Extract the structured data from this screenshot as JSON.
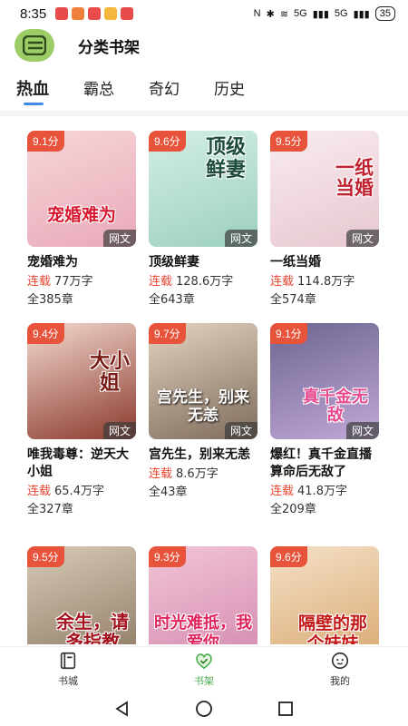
{
  "status_bar": {
    "time": "8:35",
    "network": "5G",
    "battery": "35"
  },
  "header": {
    "title": "分类书架",
    "logo_icon": "bookshelf-logo-icon"
  },
  "tabs": [
    {
      "label": "热血",
      "active": true
    },
    {
      "label": "霸总",
      "active": false
    },
    {
      "label": "奇幻",
      "active": false
    },
    {
      "label": "历史",
      "active": false
    }
  ],
  "books": [
    {
      "score": "9.1分",
      "cover_text": "宠婚难为",
      "source": "网文",
      "title": "宠婚难为",
      "status": "连载",
      "words": "77万字",
      "chapters": "全385章",
      "colors": [
        "#f6d6d9",
        "#e9a9b8"
      ]
    },
    {
      "score": "9.6分",
      "cover_text": "顶级鲜妻",
      "source": "网文",
      "title": "顶级鲜妻",
      "status": "连载",
      "words": "128.6万字",
      "chapters": "全643章",
      "colors": [
        "#d4efe4",
        "#9ccfc0"
      ]
    },
    {
      "score": "9.5分",
      "cover_text": "一纸当婚",
      "source": "网文",
      "title": "一纸当婚",
      "status": "连载",
      "words": "114.8万字",
      "chapters": "全574章",
      "colors": [
        "#f8ecef",
        "#e7c7cf"
      ]
    },
    {
      "score": "9.4分",
      "cover_text": "大小姐",
      "source": "网文",
      "title": "唯我毒尊：逆天大小姐",
      "status": "连载",
      "words": "65.4万字",
      "chapters": "全327章",
      "colors": [
        "#f3d9cf",
        "#8c3a2e"
      ]
    },
    {
      "score": "9.7分",
      "cover_text": "宫先生，别来无恙",
      "source": "网文",
      "title": "宫先生，别来无恙",
      "status": "连载",
      "words": "8.6万字",
      "chapters": "全43章",
      "colors": [
        "#e4d3c0",
        "#7f6c5c"
      ]
    },
    {
      "score": "9.1分",
      "cover_text": "真千金无敌",
      "source": "网文",
      "title": "爆红！真千金直播算命后无敌了",
      "status": "连载",
      "words": "41.8万字",
      "chapters": "全209章",
      "colors": [
        "#6c6590",
        "#c2a8d8"
      ]
    },
    {
      "score": "9.5分",
      "cover_text": "余生，请多指教",
      "colors": [
        "#d7cab7",
        "#8e7a63"
      ]
    },
    {
      "score": "9.3分",
      "cover_text": "时光难抵，我爱你",
      "colors": [
        "#f2c5d6",
        "#d48ab0"
      ]
    },
    {
      "score": "9.6分",
      "cover_text": "隔壁的那个妹妹",
      "colors": [
        "#f4e1c8",
        "#d9a870"
      ]
    }
  ],
  "bottom_nav": [
    {
      "label": "书城",
      "icon": "book-city-icon",
      "active": false
    },
    {
      "label": "书架",
      "icon": "bookshelf-heart-icon",
      "active": true
    },
    {
      "label": "我的",
      "icon": "profile-chat-icon",
      "active": false
    }
  ],
  "colors": {
    "accent_green": "#4caf50",
    "score_red": "#e8533b",
    "tab_indicator": "#3d8de6"
  }
}
